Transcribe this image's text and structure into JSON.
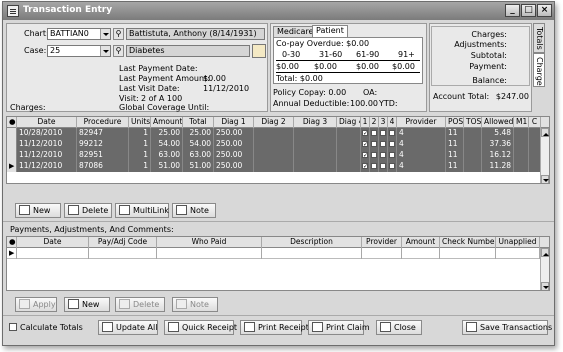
{
  "window": {
    "title": "Transaction Entry",
    "minimize": "_",
    "maximize": "□",
    "close": "×"
  },
  "header": {
    "chart_label": "Chart:",
    "chart_value": "BATTIAN0",
    "chart_patient": "Battistuta, Anthony  (8/14/1931)",
    "case_label": "Case:",
    "case_value": "25",
    "case_desc": "Diabetes",
    "charges_label": "Charges:",
    "last_payment_date_label": "Last Payment Date:",
    "last_payment_amount_label": "Last Payment Amount:",
    "last_payment_amount_value": "$0.00",
    "last_visit_date_label": "Last Visit Date:",
    "last_visit_date_value": "11/12/2010",
    "visit_label": "Visit:",
    "visit_value": "2  of  A 100",
    "global_coverage_label": "Global Coverage Until:"
  },
  "aging": {
    "tabs": [
      "Medicare",
      "Patient"
    ],
    "copay_overdue": "Co-pay Overdue: $0.00",
    "buckets": [
      "0-30",
      "31-60",
      "61-90",
      "91+"
    ],
    "values": [
      "$0.00",
      "$0.00",
      "$0.00",
      "$0.00"
    ],
    "total": "Total: $0.00",
    "policy_copay": "Policy Copay: 0.00",
    "oa": "OA:",
    "annual_deductible": "Annual Deductible:",
    "annual_deductible_value": "100.00",
    "ytd": "YTD:"
  },
  "totals": {
    "charges": "Charges:",
    "adjustments": "Adjustments:",
    "subtotal": "Subtotal:",
    "payment": "Payment:",
    "balance": "Balance:",
    "account_total_label": "Account Total:",
    "account_total_value": "$247.00",
    "side_tabs": [
      "Totals",
      "Charge"
    ]
  },
  "charges_grid": {
    "columns": [
      "Date",
      "Procedure",
      "Units",
      "Amount",
      "Total",
      "Diag 1",
      "Diag 2",
      "Diag 3",
      "Diag 4",
      "1",
      "2",
      "3",
      "4",
      "Provider",
      "POS",
      "TOS",
      "Allowed",
      "M1",
      "C"
    ],
    "rows": [
      {
        "date": "10/28/2010",
        "procedure": "82947",
        "units": "1",
        "amount": "25.00",
        "total": "25.00",
        "diag1": "250.00",
        "provider": "4",
        "pos": "11",
        "allowed": "5.48"
      },
      {
        "date": "11/12/2010",
        "procedure": "99212",
        "units": "1",
        "amount": "54.00",
        "total": "54.00",
        "diag1": "250.00",
        "provider": "4",
        "pos": "11",
        "allowed": "37.36"
      },
      {
        "date": "11/12/2010",
        "procedure": "82951",
        "units": "1",
        "amount": "63.00",
        "total": "63.00",
        "diag1": "250.00",
        "provider": "4",
        "pos": "11",
        "allowed": "16.12"
      },
      {
        "date": "11/12/2010",
        "procedure": "87086",
        "units": "1",
        "amount": "51.00",
        "total": "51.00",
        "diag1": "250.00",
        "provider": "4",
        "pos": "11",
        "allowed": "11.28"
      }
    ]
  },
  "charge_buttons": {
    "new": "New",
    "delete": "Delete",
    "multilink": "MultiLink",
    "note": "Note"
  },
  "payments": {
    "section_label": "Payments, Adjustments, And Comments:",
    "columns": [
      "Date",
      "Pay/Adj Code",
      "Who Paid",
      "Description",
      "Provider",
      "Amount",
      "Check Number",
      "Unapplied"
    ]
  },
  "payment_buttons": {
    "apply": "Apply",
    "new": "New",
    "delete": "Delete",
    "note": "Note"
  },
  "footer": {
    "calculate_totals": "Calculate Totals",
    "update_all": "Update All",
    "quick_receipt": "Quick Receipt",
    "print_receipt": "Print Receipt",
    "print_claim": "Print Claim",
    "close": "Close",
    "save_transactions": "Save Transactions"
  }
}
